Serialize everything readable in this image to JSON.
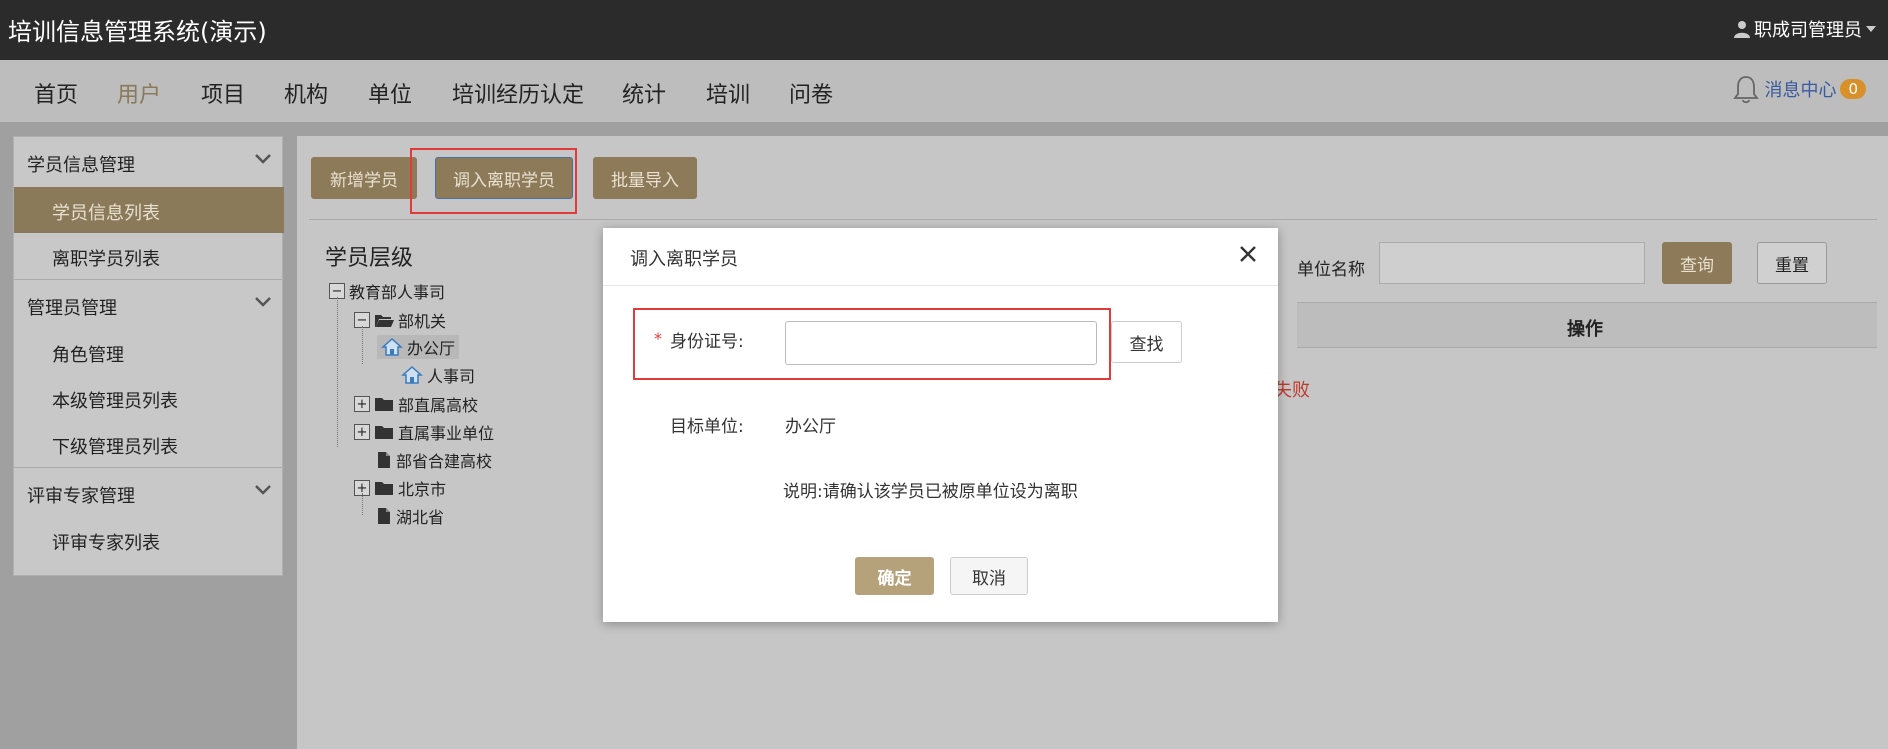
{
  "header": {
    "app_title": "培训信息管理系统(演示)",
    "user_name": "职成司管理员"
  },
  "nav": {
    "items": [
      "首页",
      "用户",
      "项目",
      "机构",
      "单位",
      "培训经历认定",
      "统计",
      "培训",
      "问卷"
    ],
    "active": "用户",
    "message_center": "消息中心",
    "message_count": "0"
  },
  "sidebar": {
    "groups": [
      {
        "label": "学员信息管理",
        "items": [
          "学员信息列表",
          "离职学员列表"
        ]
      },
      {
        "label": "管理员管理",
        "items": [
          "角色管理",
          "本级管理员列表",
          "下级管理员列表"
        ]
      },
      {
        "label": "评审专家管理",
        "items": [
          "评审专家列表"
        ]
      }
    ],
    "active_item": "学员信息列表"
  },
  "toolbar": {
    "add_label": "新增学员",
    "transfer_label": "调入离职学员",
    "import_label": "批量导入"
  },
  "tree": {
    "title": "学员层级",
    "root": "教育部人事司",
    "nodes": [
      "部机关",
      "办公厅",
      "人事司",
      "部直属高校",
      "直属事业单位",
      "部省合建高校",
      "北京市",
      "湖北省"
    ],
    "selected": "办公厅"
  },
  "filter": {
    "unit_label": "单位名称",
    "unit_value": "",
    "query_label": "查询",
    "reset_label": "重置"
  },
  "table": {
    "col_action": "操作",
    "partial_text": "失败"
  },
  "modal": {
    "title": "调入离职学员",
    "required_mark": "*",
    "id_label": "身份证号:",
    "id_value": "",
    "find_label": "查找",
    "target_label": "目标单位:",
    "target_value": "办公厅",
    "note": "说明:请确认该学员已被原单位设为离职",
    "ok_label": "确定",
    "cancel_label": "取消"
  },
  "colors": {
    "accent": "#8c7a58",
    "highlight": "#e23a3a",
    "badge": "#d8912a"
  }
}
